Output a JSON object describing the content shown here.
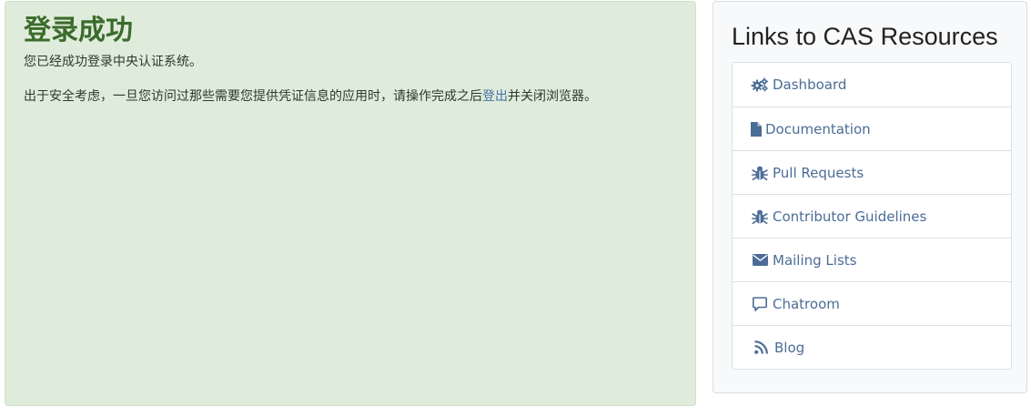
{
  "success": {
    "title": "登录成功",
    "message": "您已经成功登录中央认证系统。",
    "security_pre": "出于安全考虑，一旦您访问过那些需要您提供凭证信息的应用时，请操作完成之后",
    "logout_link": "登出",
    "security_post": "并关闭浏览器。"
  },
  "resources": {
    "title": "Links to CAS Resources",
    "items": [
      {
        "label": "Dashboard",
        "icon": "gears-icon"
      },
      {
        "label": "Documentation",
        "icon": "file-icon"
      },
      {
        "label": "Pull Requests",
        "icon": "bug-icon"
      },
      {
        "label": "Contributor Guidelines",
        "icon": "bug-icon"
      },
      {
        "label": "Mailing Lists",
        "icon": "envelope-icon"
      },
      {
        "label": "Chatroom",
        "icon": "chat-bubble-icon"
      },
      {
        "label": "Blog",
        "icon": "rss-icon"
      }
    ]
  },
  "colors": {
    "success_bg": "#e0ecdb",
    "success_title": "#3b6b2b",
    "link": "#456fa6",
    "resource_link": "#4b6c96"
  }
}
